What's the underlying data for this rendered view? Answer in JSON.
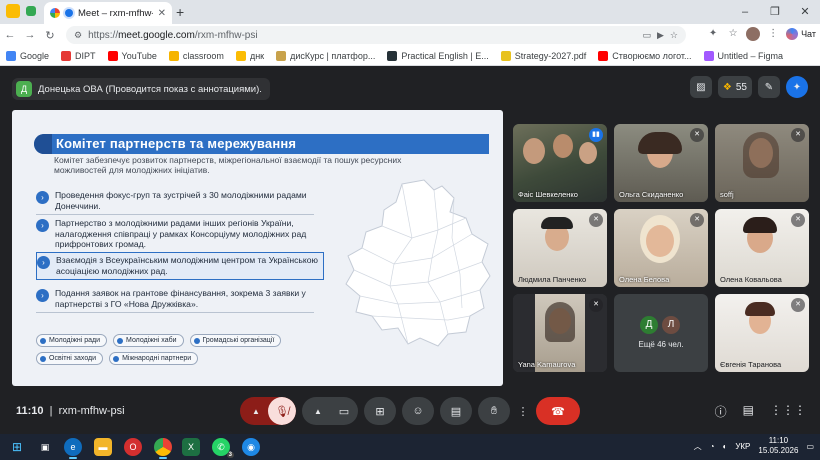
{
  "browser": {
    "tab_title": "Meet – rxm-mfhw-psi",
    "url_prefix": "https://",
    "url_host": "meet.google.com",
    "url_path": "/rxm-mfhw-psi",
    "chat_label": "Чат",
    "bookmarks": [
      {
        "label": "Google",
        "color": "#4285f4"
      },
      {
        "label": "DIPT",
        "color": "#e53935"
      },
      {
        "label": "YouTube",
        "color": "#ff0000"
      },
      {
        "label": "classroom",
        "color": "#f6b400"
      },
      {
        "label": "днк",
        "color": "#fbbc04"
      },
      {
        "label": "дисКурс | платфор...",
        "color": "#c8a24b"
      },
      {
        "label": "Practical English | E...",
        "color": "#263238"
      },
      {
        "label": "Strategy-2027.pdf",
        "color": "#e8c21f"
      },
      {
        "label": "Створюємо логот...",
        "color": "#ff0000"
      },
      {
        "label": "Untitled – Figma",
        "color": "#a259ff"
      }
    ]
  },
  "meet": {
    "presenter_initial": "Д",
    "presenter_label": "Донецька ОВА (Проводится показ с аннотациями).",
    "participants_count": "55",
    "time": "11:10",
    "meeting_code": "rxm-mfhw-psi"
  },
  "slide": {
    "title": "Комітет партнерств та мережування",
    "description": "Комітет забезпечує розвиток партнерств, міжрегіональної взаємодії та пошук ресурсних можливостей для молодіжних ініціатив.",
    "items": [
      "Проведення фокус-груп та зустрічей з 30 молодіжними радами Донеччини.",
      "Партнерство з молодіжними радами інших регіонів України, налагодження співпраці у рамках Консорціуму молодіжних рад прифронтових громад.",
      "Взаємодія з Всеукраїнським молодіжним центром та Українською асоціацією молодіжних рад.",
      "Подання заявок на грантове фінансування, зокрема 3 заявки у партнерстві з ГО «Нова Дружківка»."
    ],
    "tags": [
      "Молодіжні ради",
      "Молодіжні хаби",
      "Громадські організації",
      "Освітні заходи",
      "Міжнародні партнери"
    ]
  },
  "participants": [
    {
      "name": "Фаіс Шевкеленко",
      "muted": false
    },
    {
      "name": "Ольга Скиданенко",
      "muted": true
    },
    {
      "name": "soffj",
      "muted": true
    },
    {
      "name": "Людмила Панченко",
      "muted": true
    },
    {
      "name": "Олена Белова",
      "muted": true
    },
    {
      "name": "Олена Ковальова",
      "muted": true
    },
    {
      "name": "Yana Kamaurova",
      "muted": true
    },
    {
      "name": "Євгенія Таранова",
      "muted": true
    }
  ],
  "more": {
    "avatars": [
      {
        "letter": "Д",
        "color": "#2e7d32"
      },
      {
        "letter": "Л",
        "color": "#6d4c41"
      }
    ],
    "label": "Ещё 46 чел."
  },
  "taskbar": {
    "lang": "УКР",
    "time": "11:10",
    "date": "15.05.2026",
    "whatsapp_badge": "3"
  }
}
